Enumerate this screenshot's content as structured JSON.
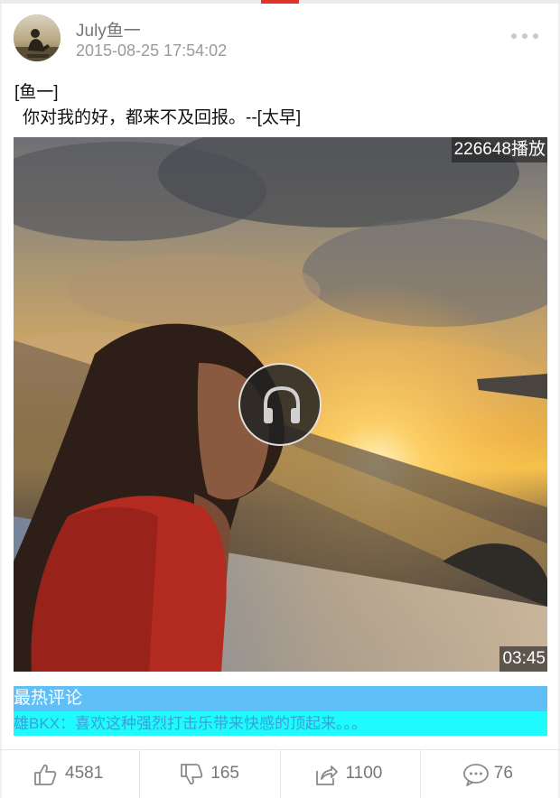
{
  "header": {
    "username": "July鱼一",
    "timestamp": "2015-08-25 17:54:02"
  },
  "post": {
    "line1": "[鱼一]",
    "line2": "你对我的好，都来不及回报。--[太早]"
  },
  "video": {
    "play_count": "226648播放",
    "duration": "03:45"
  },
  "comments": {
    "header": "最热评论",
    "top_comment": "雄BKX：喜欢这种强烈打击乐带来快感的顶起来。。。"
  },
  "actions": {
    "likes": "4581",
    "dislikes": "165",
    "shares": "1100",
    "comments": "76"
  },
  "colors": {
    "accent": "#e0332b",
    "comment_header_bg": "#60bff7",
    "comment_bg": "#1ffafd",
    "comment_text": "#3aa0d7"
  },
  "icons": [
    "more-icon",
    "headphones-icon",
    "thumbs-up-icon",
    "thumbs-down-icon",
    "share-icon",
    "comment-icon"
  ]
}
